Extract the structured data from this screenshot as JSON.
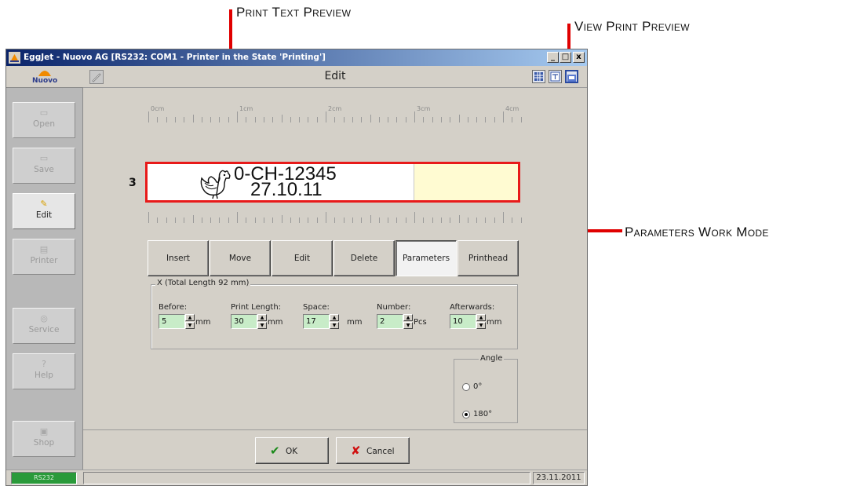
{
  "annotations": {
    "print_text_preview": "Print Text Preview",
    "view_print_preview": "View Print Preview",
    "parameters_work_mode": "Parameters Work Mode"
  },
  "window": {
    "title": "EggJet - Nuovo AG   [RS232: COM1 - Printer in the State 'Printing']",
    "minimize": "_",
    "maximize": "□",
    "close": "x"
  },
  "sidebar": {
    "logo": "Nuovo",
    "items": [
      {
        "label": "Open",
        "icon": "folder-icon",
        "active": false
      },
      {
        "label": "Save",
        "icon": "disk-icon",
        "active": false
      },
      {
        "label": "Edit",
        "icon": "pencil-icon",
        "active": true
      },
      {
        "label": "Printer",
        "icon": "printer-icon",
        "active": false
      },
      {
        "label": "Service",
        "icon": "service-icon",
        "active": false
      },
      {
        "label": "Help",
        "icon": "help-icon",
        "active": false
      },
      {
        "label": "Shop",
        "icon": "shop-icon",
        "active": false
      }
    ]
  },
  "header": {
    "title": "Edit"
  },
  "ruler": {
    "labels": [
      "0cm",
      "1cm",
      "2cm",
      "3cm",
      "4cm"
    ]
  },
  "preview": {
    "row_number": "3",
    "line1": "0-CH-12345",
    "line2": "27.10.11",
    "icon": "hen-icon",
    "border_color": "#e81a1a"
  },
  "modes": {
    "buttons": [
      "Insert",
      "Move",
      "Edit",
      "Delete",
      "Parameters",
      "Printhead"
    ],
    "active": "Parameters"
  },
  "parameters": {
    "group_label": "X (Total Length 92 mm)",
    "fields": [
      {
        "label": "Before:",
        "value": "5",
        "unit": "mm"
      },
      {
        "label": "Print Length:",
        "value": "30",
        "unit": "mm"
      },
      {
        "label": "Space:",
        "value": "17",
        "unit": "mm"
      },
      {
        "label": "Number:",
        "value": "2",
        "unit": "Pcs"
      },
      {
        "label": "Afterwards:",
        "value": "10",
        "unit": "mm"
      }
    ]
  },
  "angle": {
    "label": "Angle",
    "options": [
      "0°",
      "180°"
    ],
    "selected": "180°"
  },
  "footer": {
    "ok": "OK",
    "cancel": "Cancel"
  },
  "statusbar": {
    "connection": "RS232",
    "date": "23.11.2011"
  },
  "colors": {
    "accent_red": "#e00000",
    "field_green": "#c8ecc8",
    "preview_yellow": "#fffbd2"
  }
}
